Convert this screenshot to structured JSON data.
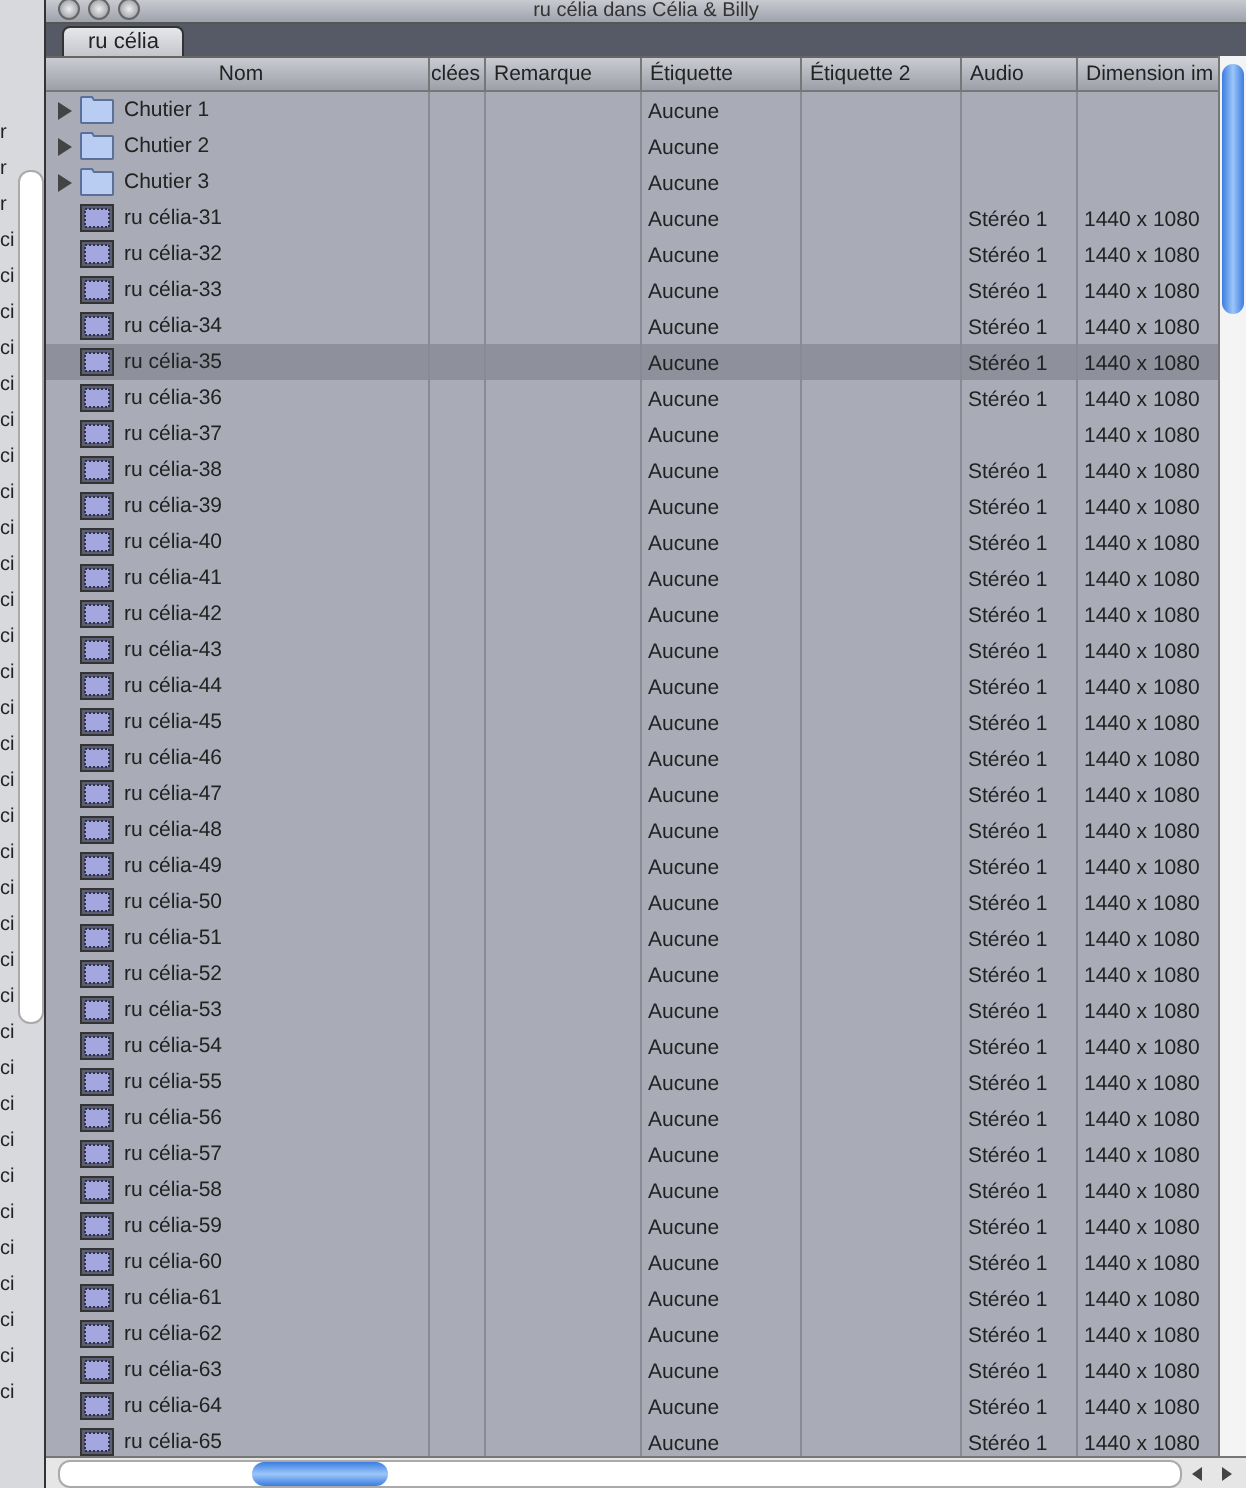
{
  "window": {
    "title": "ru célia dans Célia & Billy"
  },
  "tabs": [
    {
      "label": "ru célia",
      "selected": true
    }
  ],
  "background_window": {
    "items": [
      "r",
      "r",
      "r",
      "ci",
      "ci",
      "ci",
      "ci",
      "ci",
      "ci",
      "ci",
      "ci",
      "ci",
      "ci",
      "ci",
      "ci",
      "ci",
      "ci",
      "ci",
      "ci",
      "ci",
      "ci",
      "ci",
      "ci",
      "ci",
      "ci",
      "ci",
      "ci",
      "ci",
      "ci",
      "ci",
      "ci",
      "ci",
      "ci",
      "ci",
      "ci",
      "ci"
    ]
  },
  "table": {
    "columns": [
      {
        "label": "Nom"
      },
      {
        "label": "clées"
      },
      {
        "label": "Remarque"
      },
      {
        "label": "Étiquette"
      },
      {
        "label": "Étiquette 2"
      },
      {
        "label": "Audio"
      },
      {
        "label": "Dimension im"
      }
    ],
    "rows": [
      {
        "kind": "folder",
        "expanded": false,
        "selected": false,
        "name": "Chutier 1",
        "label": "Aucune"
      },
      {
        "kind": "folder",
        "expanded": false,
        "selected": false,
        "name": "Chutier 2",
        "label": "Aucune"
      },
      {
        "kind": "folder",
        "expanded": false,
        "selected": false,
        "name": "Chutier 3",
        "label": "Aucune"
      },
      {
        "kind": "clip",
        "selected": false,
        "name": "ru célia-31",
        "label": "Aucune",
        "audio": "Stéréo 1",
        "dimension": "1440 x 1080"
      },
      {
        "kind": "clip",
        "selected": false,
        "name": "ru célia-32",
        "label": "Aucune",
        "audio": "Stéréo 1",
        "dimension": "1440 x 1080"
      },
      {
        "kind": "clip",
        "selected": false,
        "name": "ru célia-33",
        "label": "Aucune",
        "audio": "Stéréo 1",
        "dimension": "1440 x 1080"
      },
      {
        "kind": "clip",
        "selected": false,
        "name": "ru célia-34",
        "label": "Aucune",
        "audio": "Stéréo 1",
        "dimension": "1440 x 1080"
      },
      {
        "kind": "clip",
        "selected": true,
        "name": "ru célia-35",
        "label": "Aucune",
        "audio": "Stéréo 1",
        "dimension": "1440 x 1080"
      },
      {
        "kind": "clip",
        "selected": false,
        "name": "ru célia-36",
        "label": "Aucune",
        "audio": "Stéréo 1",
        "dimension": "1440 x 1080"
      },
      {
        "kind": "clip",
        "selected": false,
        "name": "ru célia-37",
        "label": "Aucune",
        "dimension": "1440 x 1080"
      },
      {
        "kind": "clip",
        "selected": false,
        "name": "ru célia-38",
        "label": "Aucune",
        "audio": "Stéréo 1",
        "dimension": "1440 x 1080"
      },
      {
        "kind": "clip",
        "selected": false,
        "name": "ru célia-39",
        "label": "Aucune",
        "audio": "Stéréo 1",
        "dimension": "1440 x 1080"
      },
      {
        "kind": "clip",
        "selected": false,
        "name": "ru célia-40",
        "label": "Aucune",
        "audio": "Stéréo 1",
        "dimension": "1440 x 1080"
      },
      {
        "kind": "clip",
        "selected": false,
        "name": "ru célia-41",
        "label": "Aucune",
        "audio": "Stéréo 1",
        "dimension": "1440 x 1080"
      },
      {
        "kind": "clip",
        "selected": false,
        "name": "ru célia-42",
        "label": "Aucune",
        "audio": "Stéréo 1",
        "dimension": "1440 x 1080"
      },
      {
        "kind": "clip",
        "selected": false,
        "name": "ru célia-43",
        "label": "Aucune",
        "audio": "Stéréo 1",
        "dimension": "1440 x 1080"
      },
      {
        "kind": "clip",
        "selected": false,
        "name": "ru célia-44",
        "label": "Aucune",
        "audio": "Stéréo 1",
        "dimension": "1440 x 1080"
      },
      {
        "kind": "clip",
        "selected": false,
        "name": "ru célia-45",
        "label": "Aucune",
        "audio": "Stéréo 1",
        "dimension": "1440 x 1080"
      },
      {
        "kind": "clip",
        "selected": false,
        "name": "ru célia-46",
        "label": "Aucune",
        "audio": "Stéréo 1",
        "dimension": "1440 x 1080"
      },
      {
        "kind": "clip",
        "selected": false,
        "name": "ru célia-47",
        "label": "Aucune",
        "audio": "Stéréo 1",
        "dimension": "1440 x 1080"
      },
      {
        "kind": "clip",
        "selected": false,
        "name": "ru célia-48",
        "label": "Aucune",
        "audio": "Stéréo 1",
        "dimension": "1440 x 1080"
      },
      {
        "kind": "clip",
        "selected": false,
        "name": "ru célia-49",
        "label": "Aucune",
        "audio": "Stéréo 1",
        "dimension": "1440 x 1080"
      },
      {
        "kind": "clip",
        "selected": false,
        "name": "ru célia-50",
        "label": "Aucune",
        "audio": "Stéréo 1",
        "dimension": "1440 x 1080"
      },
      {
        "kind": "clip",
        "selected": false,
        "name": "ru célia-51",
        "label": "Aucune",
        "audio": "Stéréo 1",
        "dimension": "1440 x 1080"
      },
      {
        "kind": "clip",
        "selected": false,
        "name": "ru célia-52",
        "label": "Aucune",
        "audio": "Stéréo 1",
        "dimension": "1440 x 1080"
      },
      {
        "kind": "clip",
        "selected": false,
        "name": "ru célia-53",
        "label": "Aucune",
        "audio": "Stéréo 1",
        "dimension": "1440 x 1080"
      },
      {
        "kind": "clip",
        "selected": false,
        "name": "ru célia-54",
        "label": "Aucune",
        "audio": "Stéréo 1",
        "dimension": "1440 x 1080"
      },
      {
        "kind": "clip",
        "selected": false,
        "name": "ru célia-55",
        "label": "Aucune",
        "audio": "Stéréo 1",
        "dimension": "1440 x 1080"
      },
      {
        "kind": "clip",
        "selected": false,
        "name": "ru célia-56",
        "label": "Aucune",
        "audio": "Stéréo 1",
        "dimension": "1440 x 1080"
      },
      {
        "kind": "clip",
        "selected": false,
        "name": "ru célia-57",
        "label": "Aucune",
        "audio": "Stéréo 1",
        "dimension": "1440 x 1080"
      },
      {
        "kind": "clip",
        "selected": false,
        "name": "ru célia-58",
        "label": "Aucune",
        "audio": "Stéréo 1",
        "dimension": "1440 x 1080"
      },
      {
        "kind": "clip",
        "selected": false,
        "name": "ru célia-59",
        "label": "Aucune",
        "audio": "Stéréo 1",
        "dimension": "1440 x 1080"
      },
      {
        "kind": "clip",
        "selected": false,
        "name": "ru célia-60",
        "label": "Aucune",
        "audio": "Stéréo 1",
        "dimension": "1440 x 1080"
      },
      {
        "kind": "clip",
        "selected": false,
        "name": "ru célia-61",
        "label": "Aucune",
        "audio": "Stéréo 1",
        "dimension": "1440 x 1080"
      },
      {
        "kind": "clip",
        "selected": false,
        "name": "ru célia-62",
        "label": "Aucune",
        "audio": "Stéréo 1",
        "dimension": "1440 x 1080"
      },
      {
        "kind": "clip",
        "selected": false,
        "name": "ru célia-63",
        "label": "Aucune",
        "audio": "Stéréo 1",
        "dimension": "1440 x 1080"
      },
      {
        "kind": "clip",
        "selected": false,
        "name": "ru célia-64",
        "label": "Aucune",
        "audio": "Stéréo 1",
        "dimension": "1440 x 1080"
      },
      {
        "kind": "clip",
        "selected": false,
        "name": "ru célia-65",
        "label": "Aucune",
        "audio": "Stéréo 1",
        "dimension": "1440 x 1080"
      }
    ]
  }
}
